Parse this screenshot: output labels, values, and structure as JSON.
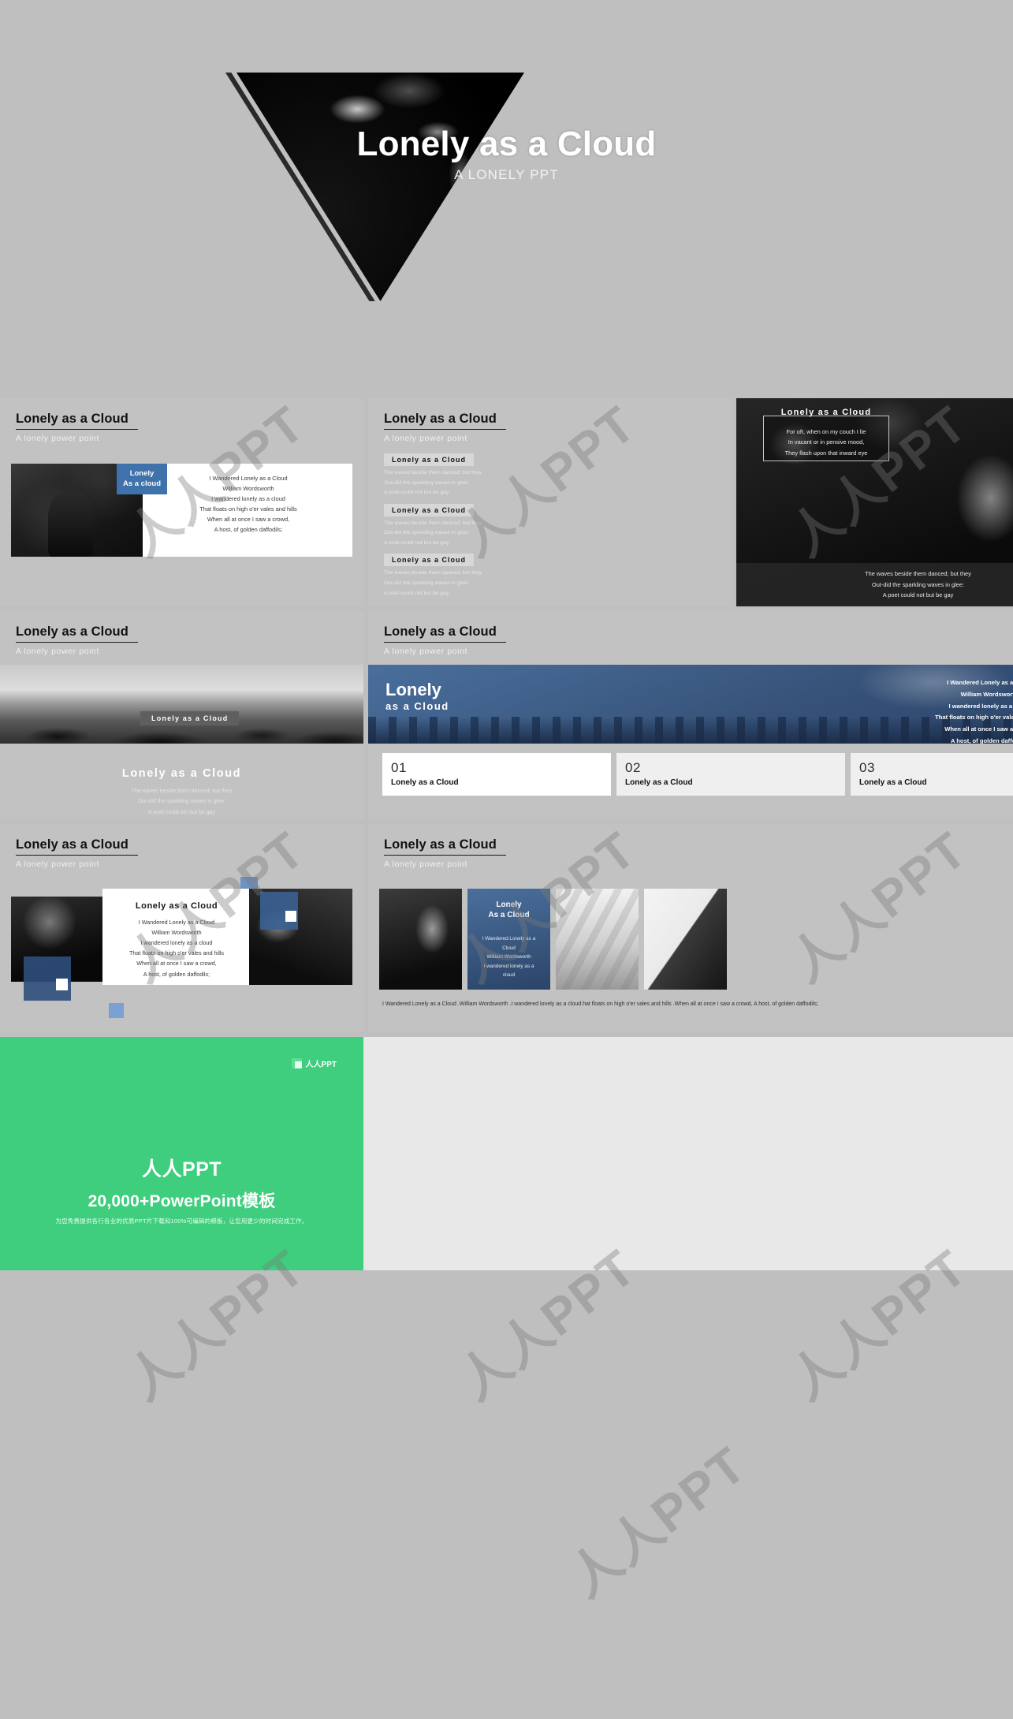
{
  "brand": {
    "name": "人人PPT",
    "watermark": "人人PPT",
    "logo_icon": "squares-logo-icon"
  },
  "cover": {
    "title": "Lonely as a Cloud",
    "subtitle": "A LONELY PPT"
  },
  "common": {
    "slide_title": "Lonely as a Cloud",
    "slide_subtitle": "A lonely  power  point",
    "section_tag": "Lonely  as  a  Cloud"
  },
  "slides": [
    {
      "id": "slide-poem-photo",
      "title": "Lonely as a Cloud",
      "subtitle": "A lonely  power  point",
      "photo_tag_line1": "Lonely",
      "photo_tag_line2": "As a cloud",
      "poem": [
        "I Wandered Lonely as a Cloud",
        "William Wordsworth",
        "I wandered lonely as a cloud",
        "That floats on high o'er vales and hills",
        "When all at once I saw a crowd,",
        "A host, of golden daffodils;"
      ]
    },
    {
      "id": "slide-list",
      "title": "Lonely as a Cloud",
      "subtitle": "A lonely  power  point",
      "items": [
        {
          "tag": "Lonely  as  a  Cloud",
          "lines": [
            "The waves beside them danced; but they",
            "Out-did the sparkling waves in glee:",
            "A poet could not but be gay"
          ]
        },
        {
          "tag": "Lonely  as  a  Cloud",
          "lines": [
            "The waves beside them danced; but they",
            "Out-did the sparkling waves in glee:",
            "A poet could not but be gay"
          ]
        },
        {
          "tag": "Lonely  as  a  Cloud",
          "lines": [
            "The waves beside them danced; but they",
            "Out-did the sparkling waves in glee:",
            "A poet could not but be gay"
          ]
        }
      ]
    },
    {
      "id": "slide-dark-photo",
      "box_title": "Lonely  as  a  Cloud",
      "box_lines": [
        "For oft, when on my couch I lie",
        "In vacant or in pensive mood,",
        "They flash upon that inward eye"
      ],
      "footer_lines": [
        "The waves beside them danced; but they",
        "Out-did the sparkling waves in glee:",
        "A poet could not but be gay"
      ]
    },
    {
      "id": "slide-seascape",
      "title": "Lonely as a Cloud",
      "subtitle": "A lonely  power  point",
      "image_tag": "Lonely  as  a  Cloud",
      "caption_title": "Lonely  as  a  Cloud",
      "caption_lines": [
        "The waves beside them danced; but they",
        "Out-did the sparkling waves in glee:",
        "A poet could not but be gay"
      ]
    },
    {
      "id": "slide-blue-banner",
      "title": "Lonely as a Cloud",
      "subtitle": "A lonely  power  point",
      "banner_line1": "Lonely",
      "banner_line2": "as  a  Cloud",
      "banner_poem": [
        "I Wandered Lonely as a Cloud",
        "William Wordsworth",
        "I wandered lonely as a cloud",
        "That floats on high o'er vales and hills",
        "When all at once I saw a crowd,",
        "A host, of golden daffodils;"
      ],
      "cards": [
        {
          "number": "01",
          "label": "Lonely as a Cloud"
        },
        {
          "number": "02",
          "label": "Lonely as a Cloud"
        },
        {
          "number": "03",
          "label": "Lonely as a Cloud"
        }
      ]
    },
    {
      "id": "slide-collage",
      "title": "Lonely as a Cloud",
      "subtitle": "A lonely  power  point",
      "panel_title": "Lonely  as  a  Cloud",
      "poem": [
        "I Wandered Lonely as a Cloud",
        "William Wordsworth",
        "I wandered lonely as a cloud",
        "That floats on high o'er vales and hills",
        "When all at once I saw a crowd,",
        "A host, of golden daffodils;"
      ]
    },
    {
      "id": "slide-thumbnails",
      "title": "Lonely as a Cloud",
      "subtitle": "A lonely  power  point",
      "thumb_title_line1": "Lonely",
      "thumb_title_line2": "As  a  Cloud",
      "thumb_lines": [
        "I Wandered Lonely as a",
        "Cloud",
        "William Wordsworth",
        "I wandered lonely as a",
        "cloud"
      ],
      "caption": "I Wandered Lonely as a Cloud .William Wordsworth .I wandered lonely as a cloud.hat floats on high o'er vales and hills .When all at once I saw a crowd,  A host, of golden daffodils;"
    }
  ],
  "footer": {
    "brand_label": "人人PPT",
    "title": "人人PPT",
    "subtitle": "20,000+PowerPoint模板",
    "note": "为您免费提供各行各业的优质PPT片下载和100%可编辑的模板，让您用更少的时间完成工作。"
  },
  "colors": {
    "background": "#bfbfbf",
    "slide_bg": "#c2c2c2",
    "accent_blue": "#3f72ab",
    "deep_blue": "#2b4468",
    "green": "#3ece7d",
    "dark": "#111111"
  }
}
